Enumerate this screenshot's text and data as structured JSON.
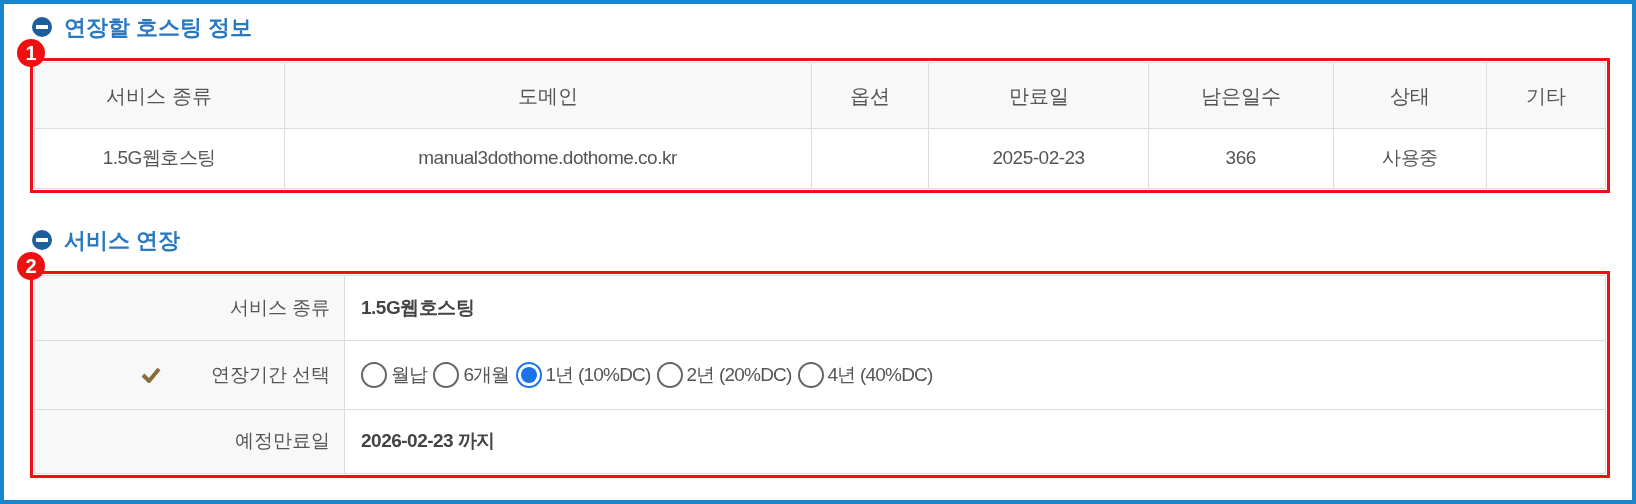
{
  "hosting_section": {
    "title": "연장할 호스팅 정보",
    "marker": "1",
    "table": {
      "columns": [
        "서비스 종류",
        "도메인",
        "옵션",
        "만료일",
        "남은일수",
        "상태",
        "기타"
      ],
      "rows": [
        [
          "1.5G웹호스팅",
          "manual3dothome.dothome.co.kr",
          "",
          "2025-02-23",
          "366",
          "사용중",
          ""
        ]
      ]
    }
  },
  "renewal_section": {
    "title": "서비스 연장",
    "marker": "2",
    "fields": [
      {
        "kind": "text",
        "label": "서비스 종류",
        "required": false,
        "value": "1.5G웹호스팅"
      },
      {
        "kind": "radio",
        "label": "연장기간 선택",
        "required": true,
        "options": [
          {
            "label": "월납",
            "selected": false
          },
          {
            "label": "6개월",
            "selected": false
          },
          {
            "label": "1년 (10%DC)",
            "selected": true
          },
          {
            "label": "2년 (20%DC)",
            "selected": false
          },
          {
            "label": "4년 (40%DC)",
            "selected": false
          }
        ]
      },
      {
        "kind": "text",
        "label": "예정만료일",
        "required": false,
        "value": "2026-02-23 까지"
      }
    ]
  }
}
